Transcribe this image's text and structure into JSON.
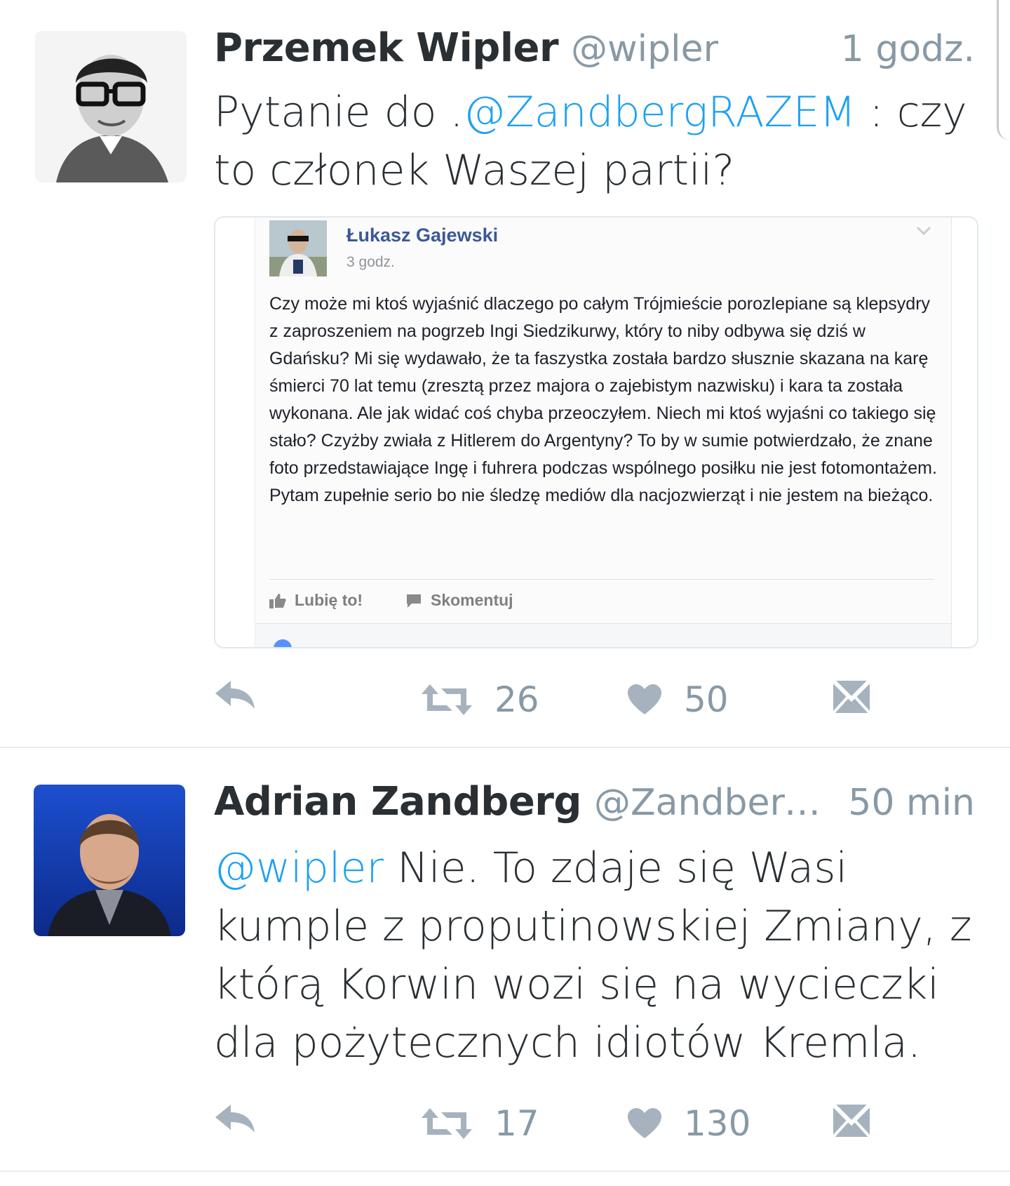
{
  "tweets": [
    {
      "name": "Przemek Wipler",
      "handle": "@wipler",
      "time": "1 godz.",
      "text_prefix": "Pytanie do .",
      "text_mention": "@ZandbergRAZEM",
      "text_suffix": " : czy to członek Waszej partii?",
      "retweets": "26",
      "likes": "50"
    },
    {
      "name": "Adrian Zandberg",
      "handle": "@ZandbergRA…",
      "time": "50 min",
      "text_mention": "@wipler",
      "text_suffix": " Nie. To zdaje się Wasi kumple z proputinowskiej Zmiany, z którą Korwin wozi się na wycieczki dla pożytecznych idiotów Kremla.",
      "retweets": "17",
      "likes": "130"
    }
  ],
  "embedded_post": {
    "author": "Łukasz Gajewski",
    "time": "3 godz.",
    "paragraph_1": "Czy może mi ktoś wyjaśnić dlaczego po całym Trójmieście porozlepiane są klepsydry z zaproszeniem na pogrzeb Ingi Siedzikurwy, który to niby odbywa się dziś w Gdańsku? Mi się wydawało, że ta faszystka została bardzo słusznie skazana na karę śmierci 70 lat temu (zresztą przez majora o zajebistym nazwisku) i kara ta została wykonana. Ale jak widać coś chyba przeoczyłem. Niech mi ktoś wyjaśni co takiego się stało? Czyżby zwiała z Hitlerem do Argentyny? To by w sumie potwierdzało, że znane foto przedstawiające Ingę i fuhrera podczas wspólnego posiłku nie jest fotomontażem.",
    "paragraph_2": "Pytam zupełnie serio bo nie śledzę mediów dla nacjozwierząt i nie jestem na bieżąco.",
    "like_label": "Lubię to!",
    "comment_label": "Skomentuj"
  },
  "icons": {
    "reply": "reply-icon",
    "retweet": "retweet-icon",
    "like": "heart-icon",
    "message": "envelope-icon"
  },
  "colors": {
    "mention": "#1da1f2",
    "action_gray": "#a6b3be",
    "fb_blue": "#3b5998"
  }
}
